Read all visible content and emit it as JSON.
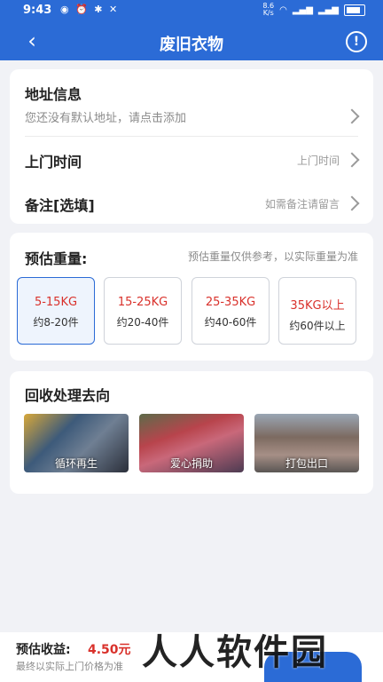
{
  "status_bar": {
    "time": "9:43",
    "net_speed_top": "8.6",
    "net_speed_bottom": "K/s"
  },
  "header": {
    "back_glyph": "‹",
    "title": "废旧衣物",
    "info_glyph": "!"
  },
  "address": {
    "label": "地址信息",
    "placeholder": "您还没有默认地址，请点击添加"
  },
  "pickup_time": {
    "label": "上门时间",
    "hint": "上门时间"
  },
  "remark": {
    "label": "备注[选填]",
    "hint": "如需备注请留言"
  },
  "weight": {
    "label": "预估重量:",
    "note": "预估重量仅供参考，以实际重量为准",
    "selected_index": 0,
    "options": [
      {
        "range": "5-15KG",
        "count": "约8-20件"
      },
      {
        "range": "15-25KG",
        "count": "约20-40件"
      },
      {
        "range": "25-35KG",
        "count": "约40-60件"
      },
      {
        "range": "35KG以上",
        "count": "约60件以上"
      }
    ]
  },
  "destination": {
    "label": "回收处理去向",
    "items": [
      {
        "caption": "循环再生"
      },
      {
        "caption": "爱心捐助"
      },
      {
        "caption": "打包出口"
      }
    ]
  },
  "footer": {
    "estimate_label": "预估收益:",
    "estimate_value": "4.50元",
    "note": "最终以实际上门价格为准"
  },
  "watermark": "人人软件园",
  "colors": {
    "brand": "#2b6bd6",
    "price": "#d9312b",
    "background": "#f1f2f6"
  }
}
